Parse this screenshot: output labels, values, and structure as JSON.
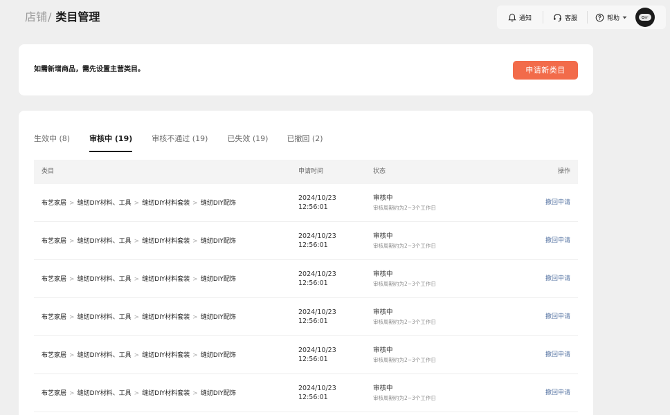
{
  "header": {
    "breadcrumb_root": "店铺",
    "breadcrumb_sep": "/",
    "title": "类目管理",
    "notify_label": "通知",
    "service_label": "客服",
    "help_label": "帮助"
  },
  "notice": {
    "text": "如需新增商品，需先设置主营类目。",
    "apply_button": "申请新类目"
  },
  "tabs": [
    {
      "label": "生效中 (8)",
      "active": false
    },
    {
      "label": "审核中 (19)",
      "active": true
    },
    {
      "label": "审核不通过 (19)",
      "active": false
    },
    {
      "label": "已失效 (19)",
      "active": false
    },
    {
      "label": "已撤回 (2)",
      "active": false
    }
  ],
  "table": {
    "columns": {
      "category": "类目",
      "time": "申请时间",
      "status": "状态",
      "action": "操作"
    },
    "rows": [
      {
        "path": [
          "布艺家居",
          "缝纫DIY材料、工具",
          "缝纫DIY材料套装",
          "缝纫DIY配饰"
        ],
        "date": "2024/10/23",
        "clock": "12:56:01",
        "status": "审核中",
        "status_note": "审核周期约为2~3个工作日",
        "action": "撤回申请"
      },
      {
        "path": [
          "布艺家居",
          "缝纫DIY材料、工具",
          "缝纫DIY材料套装",
          "缝纫DIY配饰"
        ],
        "date": "2024/10/23",
        "clock": "12:56:01",
        "status": "审核中",
        "status_note": "审核周期约为2~3个工作日",
        "action": "撤回申请"
      },
      {
        "path": [
          "布艺家居",
          "缝纫DIY材料、工具",
          "缝纫DIY材料套装",
          "缝纫DIY配饰"
        ],
        "date": "2024/10/23",
        "clock": "12:56:01",
        "status": "审核中",
        "status_note": "审核周期约为2~3个工作日",
        "action": "撤回申请"
      },
      {
        "path": [
          "布艺家居",
          "缝纫DIY材料、工具",
          "缝纫DIY材料套装",
          "缝纫DIY配饰"
        ],
        "date": "2024/10/23",
        "clock": "12:56:01",
        "status": "审核中",
        "status_note": "审核周期约为2~3个工作日",
        "action": "撤回申请"
      },
      {
        "path": [
          "布艺家居",
          "缝纫DIY材料、工具",
          "缝纫DIY材料套装",
          "缝纫DIY配饰"
        ],
        "date": "2024/10/23",
        "clock": "12:56:01",
        "status": "审核中",
        "status_note": "审核周期约为2~3个工作日",
        "action": "撤回申请"
      },
      {
        "path": [
          "布艺家居",
          "缝纫DIY材料、工具",
          "缝纫DIY材料套装",
          "缝纫DIY配饰"
        ],
        "date": "2024/10/23",
        "clock": "12:56:01",
        "status": "审核中",
        "status_note": "审核周期约为2~3个工作日",
        "action": "撤回申请"
      }
    ]
  },
  "colors": {
    "accent": "#f26b4a",
    "link": "#5b78a6",
    "page_bg": "#efefef"
  },
  "icons": [
    "bell-icon",
    "headset-icon",
    "help-circle-icon",
    "caret-down-icon"
  ]
}
